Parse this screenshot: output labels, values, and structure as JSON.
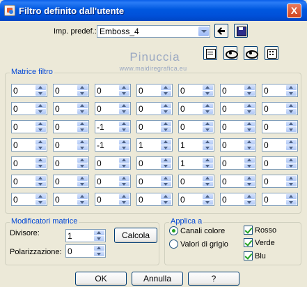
{
  "window": {
    "title": "Filtro definito dall'utente",
    "close_label": "X"
  },
  "preset": {
    "label": "Imp. predef.:",
    "value": "Emboss_4"
  },
  "watermark": {
    "name": "Pinuccia",
    "url": "www.maidiregrafica.eu"
  },
  "matrix": {
    "title": "Matrice filtro",
    "rows": [
      [
        "0",
        "0",
        "0",
        "0",
        "0",
        "0",
        "0"
      ],
      [
        "0",
        "0",
        "0",
        "0",
        "0",
        "0",
        "0"
      ],
      [
        "0",
        "0",
        "-1",
        "0",
        "0",
        "0",
        "0"
      ],
      [
        "0",
        "0",
        "-1",
        "1",
        "1",
        "0",
        "0"
      ],
      [
        "0",
        "0",
        "0",
        "0",
        "1",
        "0",
        "0"
      ],
      [
        "0",
        "0",
        "0",
        "0",
        "0",
        "0",
        "0"
      ],
      [
        "0",
        "0",
        "0",
        "0",
        "0",
        "0",
        "0"
      ]
    ]
  },
  "modifiers": {
    "title": "Modificatori matrice",
    "divisor_label": "Divisore:",
    "divisor_value": "1",
    "bias_label": "Polarizzazione:",
    "bias_value": "0",
    "calc_button": "Calcola"
  },
  "apply": {
    "title": "Applica a",
    "radio_color": "Canali colore",
    "radio_gray": "Valori di grigio",
    "selected_mode": "color",
    "red": "Rosso",
    "green": "Verde",
    "blue": "Blu",
    "red_checked": true,
    "green_checked": true,
    "blue_checked": true
  },
  "buttons": {
    "ok": "OK",
    "cancel": "Annulla",
    "help": "?"
  },
  "colors": {
    "titlebar": "#0058e0",
    "group_title": "#0046d5",
    "dialog_bg": "#ece9d8"
  }
}
